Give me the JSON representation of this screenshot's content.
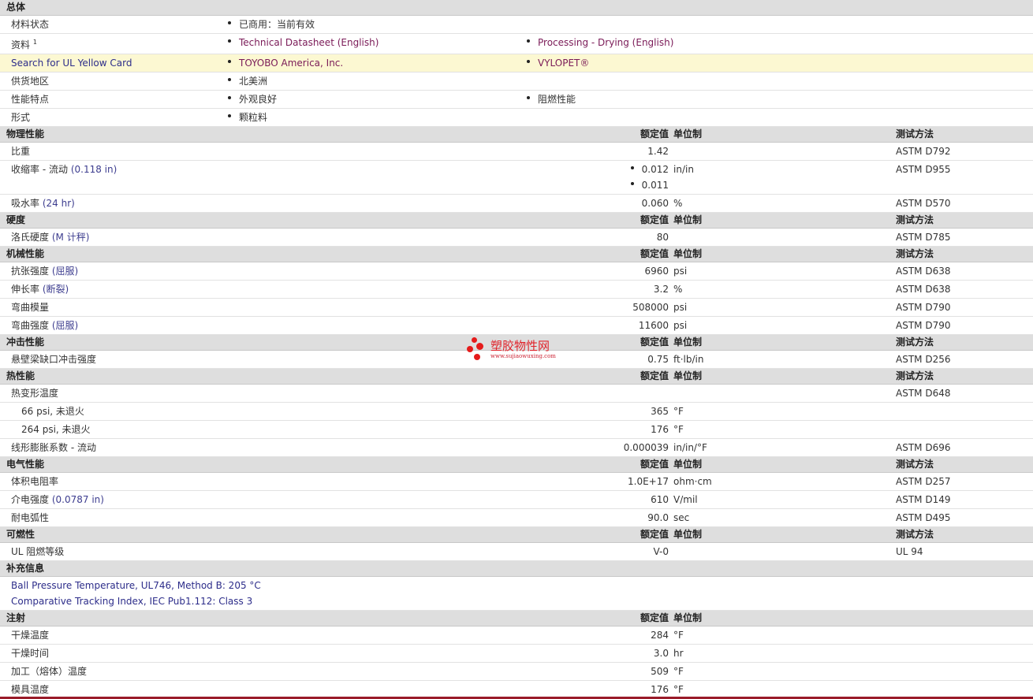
{
  "overview": {
    "title": "总体",
    "material_status": {
      "label": "材料状态",
      "value": "已商用：当前有效"
    },
    "docs": {
      "label": "资料",
      "sup": "1",
      "link1": "Technical Datasheet (English)",
      "link2": "Processing - Drying (English)"
    },
    "ul": {
      "label": "Search for UL Yellow Card",
      "link1": "TOYOBO America, Inc.",
      "link2": "VYLOPET®"
    },
    "region": {
      "label": "供货地区",
      "value": "北美洲"
    },
    "features": {
      "label": "性能特点",
      "value1": "外观良好",
      "value2": "阻燃性能"
    },
    "form": {
      "label": "形式",
      "value": "颗粒料"
    }
  },
  "headers": {
    "nominal": "额定值",
    "unit": "单位制",
    "method": "测试方法"
  },
  "physical": {
    "title": "物理性能",
    "rows": [
      {
        "label": "比重",
        "cond": "",
        "value": "1.42",
        "unit": "",
        "method": "ASTM D792"
      },
      {
        "label": "吸水率",
        "cond": "(24 hr)",
        "value": "0.060",
        "unit": "%",
        "method": "ASTM D570"
      }
    ],
    "shrink": {
      "label": "收缩率",
      "cond1": " - 流动",
      "cond2": "(0.118 in)",
      "value1": "0.012",
      "unit1": "in/in",
      "value2": "0.011",
      "method": "ASTM D955"
    }
  },
  "hardness": {
    "title": "硬度",
    "rows": [
      {
        "label": "洛氏硬度",
        "cond": "(M 计秤)",
        "value": "80",
        "unit": "",
        "method": "ASTM D785"
      }
    ]
  },
  "mechanical": {
    "title": "机械性能",
    "rows": [
      {
        "label": "抗张强度",
        "cond": "(屈服)",
        "value": "6960",
        "unit": "psi",
        "method": "ASTM D638"
      },
      {
        "label": "伸长率",
        "cond": "(断裂)",
        "value": "3.2",
        "unit": "%",
        "method": "ASTM D638"
      },
      {
        "label": "弯曲模量",
        "cond": "",
        "value": "508000",
        "unit": "psi",
        "method": "ASTM D790"
      },
      {
        "label": "弯曲强度",
        "cond": "(屈服)",
        "value": "11600",
        "unit": "psi",
        "method": "ASTM D790"
      }
    ]
  },
  "impact": {
    "title": "冲击性能",
    "rows": [
      {
        "label": "悬壁梁缺口冲击强度",
        "cond": "",
        "value": "0.75",
        "unit": "ft·lb/in",
        "method": "ASTM D256"
      }
    ]
  },
  "thermal": {
    "title": "热性能",
    "hdt": {
      "label": "热变形温度",
      "method": "ASTM D648"
    },
    "sub": [
      {
        "label": "66 psi, 未退火",
        "value": "365",
        "unit": "°F"
      },
      {
        "label": "264 psi, 未退火",
        "value": "176",
        "unit": "°F"
      }
    ],
    "clte": {
      "label": "线形膨胀系数",
      "cond": " - 流动",
      "value": "0.000039",
      "unit": "in/in/°F",
      "method": "ASTM D696"
    }
  },
  "electrical": {
    "title": "电气性能",
    "rows": [
      {
        "label": "体积电阻率",
        "cond": "",
        "value": "1.0E+17",
        "unit": "ohm·cm",
        "method": "ASTM D257"
      },
      {
        "label": "介电强度",
        "cond": "(0.0787 in)",
        "value": "610",
        "unit": "V/mil",
        "method": "ASTM D149"
      },
      {
        "label": "耐电弧性",
        "cond": "",
        "value": "90.0",
        "unit": "sec",
        "method": "ASTM D495"
      }
    ]
  },
  "flammability": {
    "title": "可燃性",
    "rows": [
      {
        "label": "UL 阻燃等级",
        "cond": "",
        "value": "V-0",
        "unit": "",
        "method": "UL 94"
      }
    ]
  },
  "supplement": {
    "title": "补充信息",
    "line1": "Ball Pressure Temperature, UL746, Method B: 205 °C",
    "line2": "Comparative Tracking Index, IEC Pub1.112: Class 3"
  },
  "injection": {
    "title": "注射",
    "rows": [
      {
        "label": "干燥温度",
        "value": "284",
        "unit": "°F"
      },
      {
        "label": "干燥时间",
        "value": "3.0",
        "unit": "hr"
      },
      {
        "label": "加工（熔体）温度",
        "value": "509",
        "unit": "°F"
      },
      {
        "label": "模具温度",
        "value": "176",
        "unit": "°F"
      }
    ]
  },
  "watermark": {
    "cn": "塑胶物性网",
    "url": "www.sujiaowuxing.com"
  },
  "colors": {
    "link": "#7a1a57",
    "highlight": "#fcf8d2",
    "section_bg": "#dedede",
    "bottom_bar": "#9a1c2a"
  }
}
